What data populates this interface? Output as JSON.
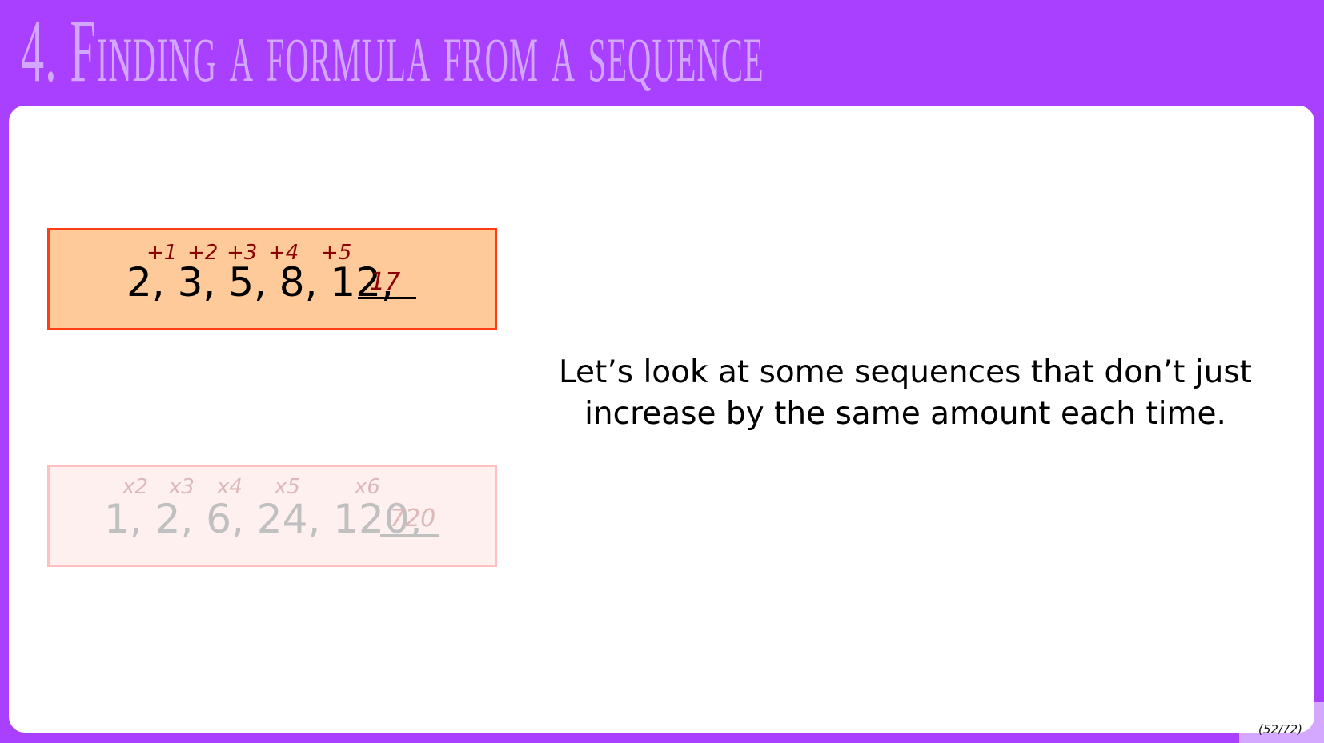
{
  "slide": {
    "title": "4. Finding a formula from a sequence",
    "message": "Let’s look at some sequences that don’t just increase by the same amount each time.",
    "page_number": "(52/72)"
  },
  "sequence_1": {
    "terms": "2, 3, 5, 8, 12,",
    "differences": [
      "+1",
      "+2",
      "+3",
      "+4",
      "+5"
    ],
    "answer": "17",
    "colors": {
      "background": "#ffca99",
      "border": "#ff3c14",
      "annotation": "#8b0000"
    }
  },
  "sequence_2": {
    "terms": "1, 2, 6, 24, 120,",
    "multipliers": [
      "x2",
      "x3",
      "x4",
      "x5",
      "x6"
    ],
    "answer": "720",
    "colors": {
      "background": "#fff0f0",
      "border": "#ffc0c0",
      "annotation": "#ddb8b8",
      "text": "#c0c0c0"
    }
  },
  "colors": {
    "header": "#a93fff",
    "title": "#d3a6ff"
  }
}
